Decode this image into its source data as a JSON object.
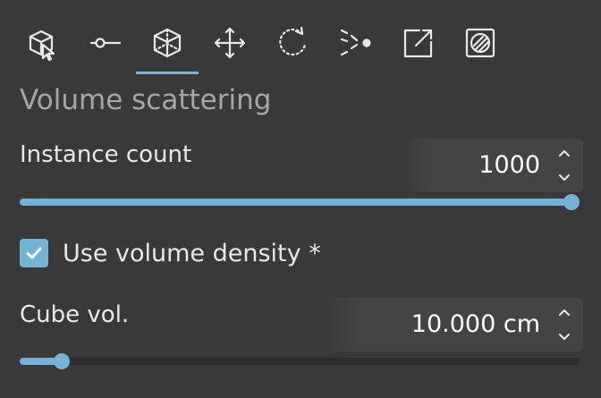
{
  "toolbar": {
    "active_index": 2,
    "tools": [
      {
        "icon": "select-cube-icon"
      },
      {
        "icon": "point-line-icon"
      },
      {
        "icon": "volume-cube-icon"
      },
      {
        "icon": "move-arrows-icon"
      },
      {
        "icon": "rotate-dashed-icon"
      },
      {
        "icon": "scatter-icon"
      },
      {
        "icon": "export-icon"
      },
      {
        "icon": "hatch-square-icon"
      }
    ]
  },
  "section": {
    "title": "Volume scattering"
  },
  "instance_count": {
    "label": "Instance count",
    "value": "1000",
    "slider_fraction": 1.0
  },
  "use_volume_density": {
    "label": "Use volume density *",
    "checked": true
  },
  "cube_vol": {
    "label": "Cube vol.",
    "value": "10.000 cm",
    "slider_fraction": 0.063
  },
  "colors": {
    "accent": "#74b3d3",
    "background": "#393939",
    "field_background": "#444444",
    "section_title": "#a6a6a6",
    "text": "#e8e8e8"
  }
}
